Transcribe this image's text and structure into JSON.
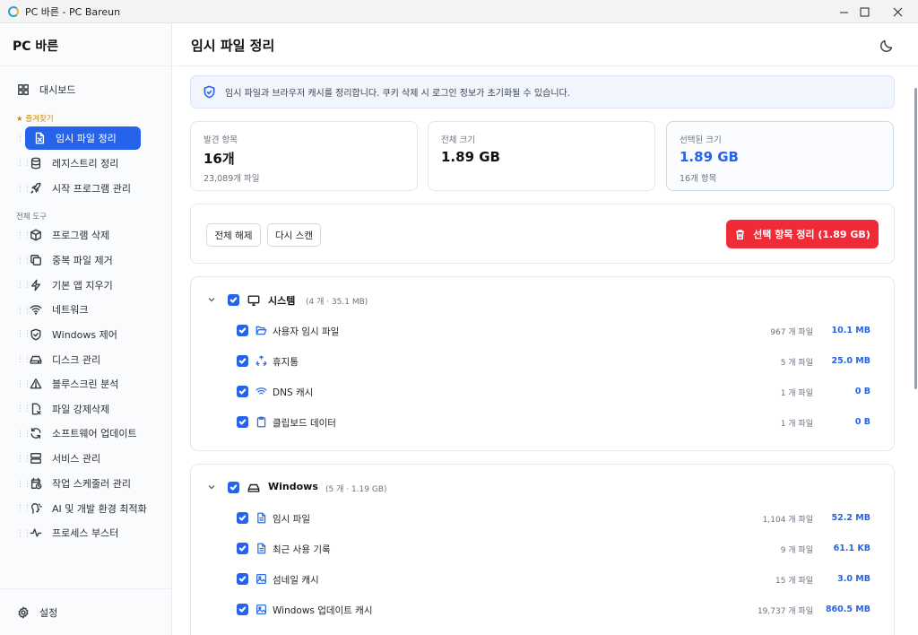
{
  "window": {
    "title": "PC 바른 - PC Bareun",
    "minimize": "—",
    "maximize": "☐",
    "close": "✕"
  },
  "sidebar": {
    "brand": "PC 바른",
    "dashboard": "대시보드",
    "favorites_label": "★ 즐겨찾기",
    "favorites": [
      {
        "label": "임시 파일 정리",
        "icon": "file-x-icon"
      },
      {
        "label": "레지스트리 정리",
        "icon": "database-icon"
      },
      {
        "label": "시작 프로그램 관리",
        "icon": "rocket-icon"
      }
    ],
    "tools_label": "전체 도구",
    "tools": [
      {
        "label": "프로그램 삭제",
        "icon": "package-icon"
      },
      {
        "label": "중복 파일 제거",
        "icon": "copy-icon"
      },
      {
        "label": "기본 앱 지우기",
        "icon": "bolt-icon"
      },
      {
        "label": "네트워크",
        "icon": "wifi-icon"
      },
      {
        "label": "Windows 제어",
        "icon": "shield-icon"
      },
      {
        "label": "디스크 관리",
        "icon": "drive-icon"
      },
      {
        "label": "블루스크린 분석",
        "icon": "warning-icon"
      },
      {
        "label": "파일 강제삭제",
        "icon": "file-delete-icon"
      },
      {
        "label": "소프트웨어 업데이트",
        "icon": "refresh-icon"
      },
      {
        "label": "서비스 관리",
        "icon": "server-icon"
      },
      {
        "label": "작업 스케줄러 관리",
        "icon": "calendar-clock-icon"
      },
      {
        "label": "AI 및 개발 환경 최적화",
        "icon": "ai-icon"
      },
      {
        "label": "프로세스 부스터",
        "icon": "activity-icon"
      }
    ],
    "settings": "설정"
  },
  "main": {
    "title": "임시 파일 정리",
    "info": "임시 파일과 브라우저 캐시를 정리합니다. 쿠키 삭제 시 로그인 정보가 초기화될 수 있습니다.",
    "stats": [
      {
        "label": "발견 항목",
        "value": "16개",
        "sub": "23,089개 파일"
      },
      {
        "label": "전체 크기",
        "value": "1.89 GB",
        "sub": ""
      },
      {
        "label": "선택된 크기",
        "value": "1.89 GB",
        "sub": "16개 항목"
      }
    ],
    "deselect_all": "전체 해제",
    "rescan": "다시 스캔",
    "clean_selected": "선택 항목 정리 (1.89 GB)",
    "groups": [
      {
        "name": "시스템",
        "meta": "(4 개 · 35.1 MB)",
        "icon": "monitor-icon",
        "items": [
          {
            "name": "사용자 임시 파일",
            "count": "967 개 파일",
            "size": "10.1 MB",
            "icon": "folder-open-icon"
          },
          {
            "name": "휴지통",
            "count": "5 개 파일",
            "size": "25.0 MB",
            "icon": "recycle-icon"
          },
          {
            "name": "DNS 캐시",
            "count": "1 개 파일",
            "size": "0 B",
            "icon": "wifi-icon"
          },
          {
            "name": "클립보드 데이터",
            "count": "1 개 파일",
            "size": "0 B",
            "icon": "clipboard-icon"
          }
        ]
      },
      {
        "name": "Windows",
        "meta": "(5 개 · 1.19 GB)",
        "icon": "drive-icon",
        "items": [
          {
            "name": "임시 파일",
            "count": "1,104 개 파일",
            "size": "52.2 MB",
            "icon": "file-text-icon"
          },
          {
            "name": "최근 사용 기록",
            "count": "9 개 파일",
            "size": "61.1 KB",
            "icon": "file-text-icon"
          },
          {
            "name": "섬네일 캐시",
            "count": "15 개 파일",
            "size": "3.0 MB",
            "icon": "image-icon"
          },
          {
            "name": "Windows 업데이트 캐시",
            "count": "19,737 개 파일",
            "size": "860.5 MB",
            "icon": "image-icon"
          }
        ]
      }
    ]
  },
  "colors": {
    "accent": "#2563eb",
    "danger": "#ef2b38",
    "favorite": "#c98a06"
  }
}
